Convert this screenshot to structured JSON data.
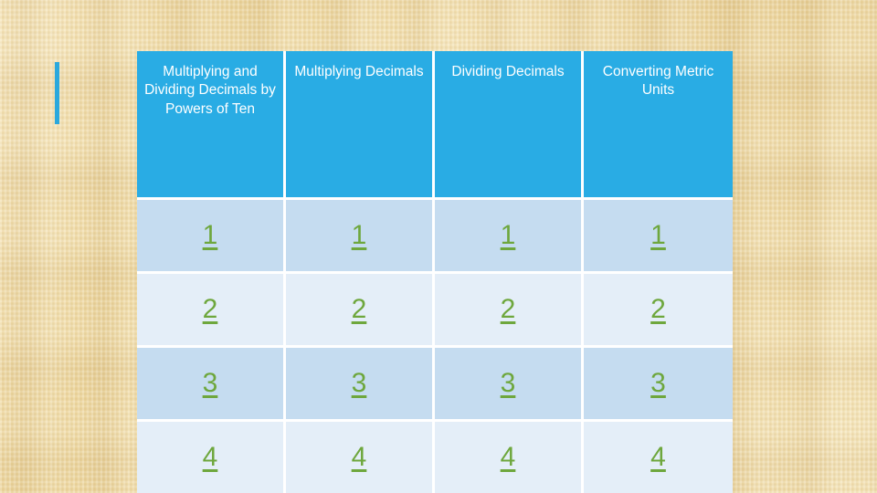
{
  "slide": {
    "background_color": "#f1dba4",
    "accent_bar_color": "#2aa8dd"
  },
  "table": {
    "header_bg": "#29ace4",
    "header_text_color": "#ffffff",
    "row_band_dark": "#c5dcf0",
    "row_band_light": "#e4eef8",
    "link_color": "#6ea73d",
    "columns": [
      {
        "label": "Multiplying and Dividing Decimals by Powers of Ten"
      },
      {
        "label": "Multiplying Decimals"
      },
      {
        "label": "Dividing Decimals"
      },
      {
        "label": "Converting Metric Units"
      }
    ],
    "rows": [
      {
        "cells": [
          "1",
          "1",
          "1",
          "1"
        ]
      },
      {
        "cells": [
          "2",
          "2",
          "2",
          "2"
        ]
      },
      {
        "cells": [
          "3",
          "3",
          "3",
          "3"
        ]
      },
      {
        "cells": [
          "4",
          "4",
          "4",
          "4"
        ]
      }
    ]
  }
}
